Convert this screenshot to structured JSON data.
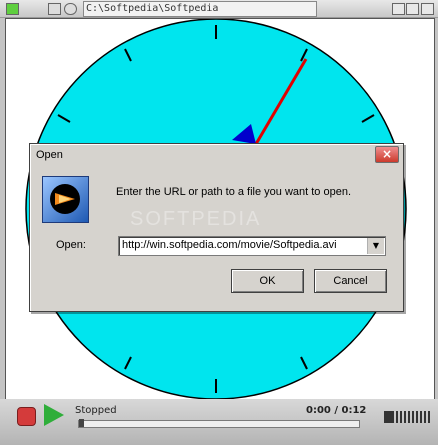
{
  "window": {
    "title": "C:\\Softpedia\\Softpedia"
  },
  "player": {
    "status": "Stopped",
    "time": "0:00 / 0:12",
    "colors": {
      "clock_face": "#00e5ee",
      "second_hand": "#e00000",
      "hour_hand": "#0000cc"
    }
  },
  "dialog": {
    "title": "Open",
    "close_icon": "close-icon",
    "message": "Enter the URL or path to a file you want to open.",
    "open_label": "Open:",
    "open_value": "http://win.softpedia.com/movie/Softpedia.avi",
    "ok_label": "OK",
    "cancel_label": "Cancel",
    "watermark": "SOFTPEDIA"
  }
}
